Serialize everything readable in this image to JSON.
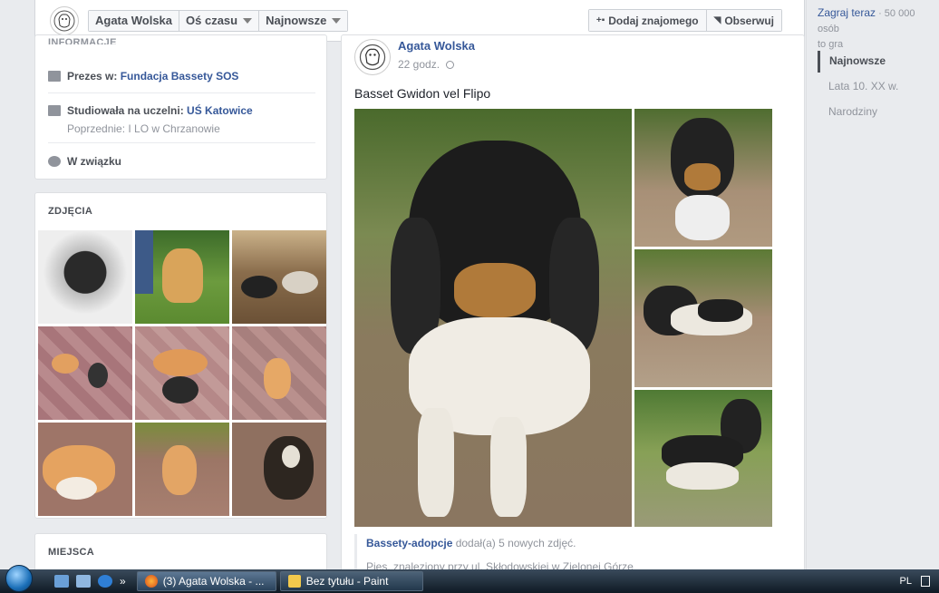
{
  "topbar": {
    "profile_name": "Agata Wolska",
    "timeline_label": "Oś czasu",
    "sort_label": "Najnowsze",
    "add_friend_label": "Dodaj znajomego",
    "follow_label": "Obserwuj"
  },
  "intro": {
    "heading": "INFORMACJE",
    "work_prefix": "Prezes w: ",
    "work_link": "Fundacja Bassety SOS",
    "edu_prefix": "Studiowała na uczelni: ",
    "edu_link": "UŚ Katowice",
    "edu_previous": "Poprzednie: I LO w Chrzanowie",
    "relationship": "W związku"
  },
  "photos": {
    "title": "ZDJĘCIA",
    "count": 9
  },
  "places": {
    "title": "MIEJSCA"
  },
  "post": {
    "author": "Agata Wolska",
    "time": "22 godz.",
    "text": "Basset Gwidon vel Flipo",
    "shared_source": "Bassety-adopcje",
    "shared_action": " dodał(a) 5 nowych zdjęć.",
    "shared_text": "Pies, znaleziony przy ul. Skłodowskiej w Zielonej Górze"
  },
  "right": {
    "game_link": "Zagraj teraz",
    "game_meta": " · 50 000 osób",
    "game_meta2": "to gra",
    "timeline": [
      "Najnowsze",
      "Lata 10. XX w.",
      "Narodziny"
    ]
  },
  "taskbar": {
    "task1": "(3) Agata Wolska - ...",
    "task2": "Bez tytułu - Paint",
    "lang": "PL",
    "chevron": "»"
  }
}
